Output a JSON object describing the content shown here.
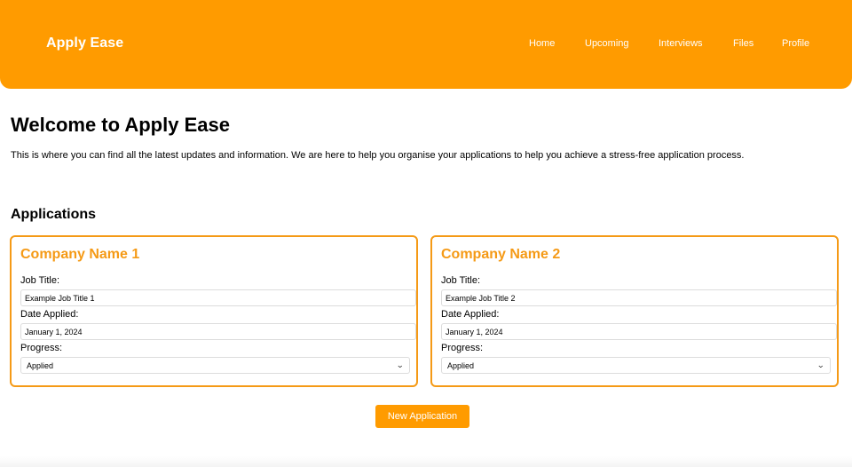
{
  "header": {
    "brand": "Apply Ease",
    "nav": [
      "Home",
      "Upcoming",
      "Interviews",
      "Files",
      "Profile"
    ],
    "background": "#ff9b00"
  },
  "main": {
    "title": "Welcome to Apply Ease",
    "intro": "This is where you can find all the latest updates and information. We are here to help you organise your applications to help you achieve a stress-free application process.",
    "section_title": "Applications",
    "accent": "#f59a16",
    "applications": [
      {
        "company": "Company Name 1",
        "job_title_label": "Job Title:",
        "job_title": "Example Job Title 1",
        "date_label": "Date Applied:",
        "date": "January 1, 2024",
        "progress_label": "Progress:",
        "progress": "Applied"
      },
      {
        "company": "Company Name 2",
        "job_title_label": "Job Title:",
        "job_title": "Example Job Title 2",
        "date_label": "Date Applied:",
        "date": "January 1, 2024",
        "progress_label": "Progress:",
        "progress": "Applied"
      }
    ],
    "new_button": "New Application",
    "select_icon": "chevron-down-icon"
  }
}
